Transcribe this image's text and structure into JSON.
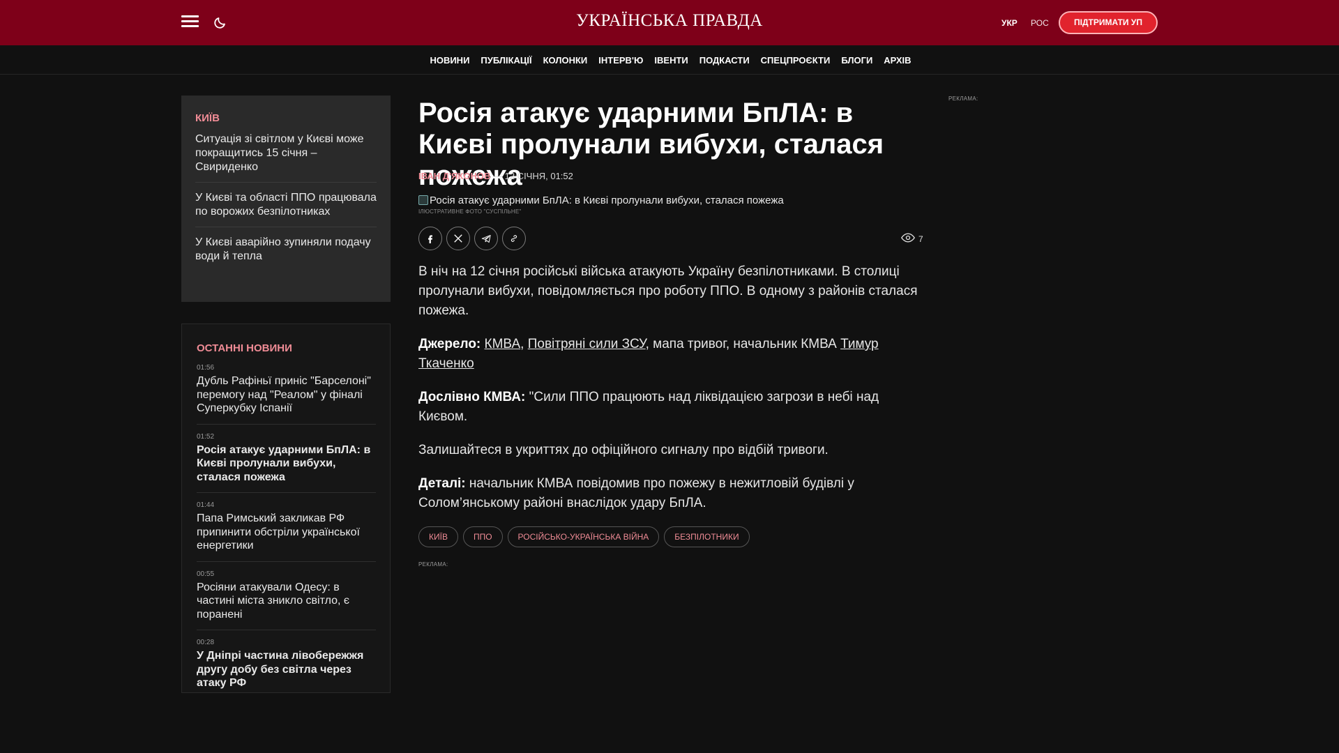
{
  "header": {
    "logo": "УКРАЇНСЬКА ПРАВДА",
    "lang_ukr": "УКР",
    "lang_ros": "РОС",
    "support_button": "ПІДТРИМАТИ УП"
  },
  "nav": {
    "items": [
      {
        "label": "НОВИНИ"
      },
      {
        "label": "ПУБЛІКАЦІЇ"
      },
      {
        "label": "КОЛОНКИ"
      },
      {
        "label": "ІНТЕРВ'Ю"
      },
      {
        "label": "ІВЕНТИ"
      },
      {
        "label": "ПОДКАСТИ"
      },
      {
        "label": "СПЕЦПРОЄКТИ"
      },
      {
        "label": "БЛОГИ"
      },
      {
        "label": "АРХІВ"
      }
    ]
  },
  "kyiv": {
    "title": "КИЇВ",
    "items": [
      {
        "text": "Ситуація зі світлом у Києві може покращитись 15 січня – Свириденко"
      },
      {
        "text": "У Києві та області ППО працювала по ворожих безпілотниках"
      },
      {
        "text": "У Києві аварійно зупиняли подачу води й тепла"
      }
    ]
  },
  "latest": {
    "title": "ОСТАННІ НОВИНИ",
    "items": [
      {
        "time": "01:56",
        "text": "Дубль Рафіньї приніс \"Барселоні\" перемогу над \"Реалом\" у фіналі Суперкубку Іспанії"
      },
      {
        "time": "01:52",
        "text": "Росія атакує ударними БпЛА: в Києві пролунали вибухи, сталася пожежа"
      },
      {
        "time": "01:44",
        "text": "Папа Римський закликав РФ припинити обстріли української енергетики"
      },
      {
        "time": "00:55",
        "text": "Росіяни атакували Одесу: в частині міста зникло світло, є поранені"
      },
      {
        "time": "00:28",
        "text": "У Дніпрі частина лівобережжя другу добу без світла через атаку РФ"
      }
    ]
  },
  "article": {
    "title": "Росія атакує ударними БпЛА: в Києві пролунали вибухи, сталася пожежа",
    "author": "ІВАН Д'ЯКОНОВ",
    "date": "— 12 СІЧНЯ, 01:52",
    "image_alt": "Росія атакує ударними БпЛА: в Києві пролунали вибухи, сталася пожежа",
    "image_caption": "ІЛЮСТРАТИВНЕ ФОТО \"СУСПІЛЬНЕ\"",
    "views": "7",
    "lead": "В ніч на 12 січня російські війська атакують Україну безпілотниками. В столиці пролунали вибухи, повідомляється про роботу ППО. В одному з районів сталася пожежа.",
    "source_label": "Джерело:",
    "source_link1": "КМВА",
    "source_sep1": ", ",
    "source_link2": "Повітряні сили ЗСУ",
    "source_middle": ", мапа тривог, начальник КМВА ",
    "source_link3": "Тимур Ткаченко",
    "quote_label": "Дослівно КМВА:",
    "quote_text": " \"Сили ППО працюють над ліквідацією загрози в небі над Києвом.",
    "quote_cont": "Залишайтеся в укриттях до офіційного сигналу про відбій тривоги.",
    "details_label": "Деталі:",
    "details_text": " начальник КМВА повідомив про пожежу в нежитловій будівлі у Солом’янському районі внаслідок удару БпЛА.",
    "tags": [
      {
        "label": "КИЇВ"
      },
      {
        "label": "ППО"
      },
      {
        "label": "РОСІЙСЬКО-УКРАЇНСЬКА ВІЙНА"
      },
      {
        "label": "БЕЗПІЛОТНИКИ"
      }
    ]
  },
  "ads": {
    "label": "РЕКЛАМА:"
  },
  "colors": {
    "header_bg": "#7e0019",
    "accent": "#f08c96",
    "support_button": "#e1232d",
    "page_bg": "#111111"
  },
  "icons": [
    "menu-icon",
    "moon-icon",
    "facebook-icon",
    "x-icon",
    "telegram-icon",
    "link-icon",
    "eye-icon"
  ]
}
